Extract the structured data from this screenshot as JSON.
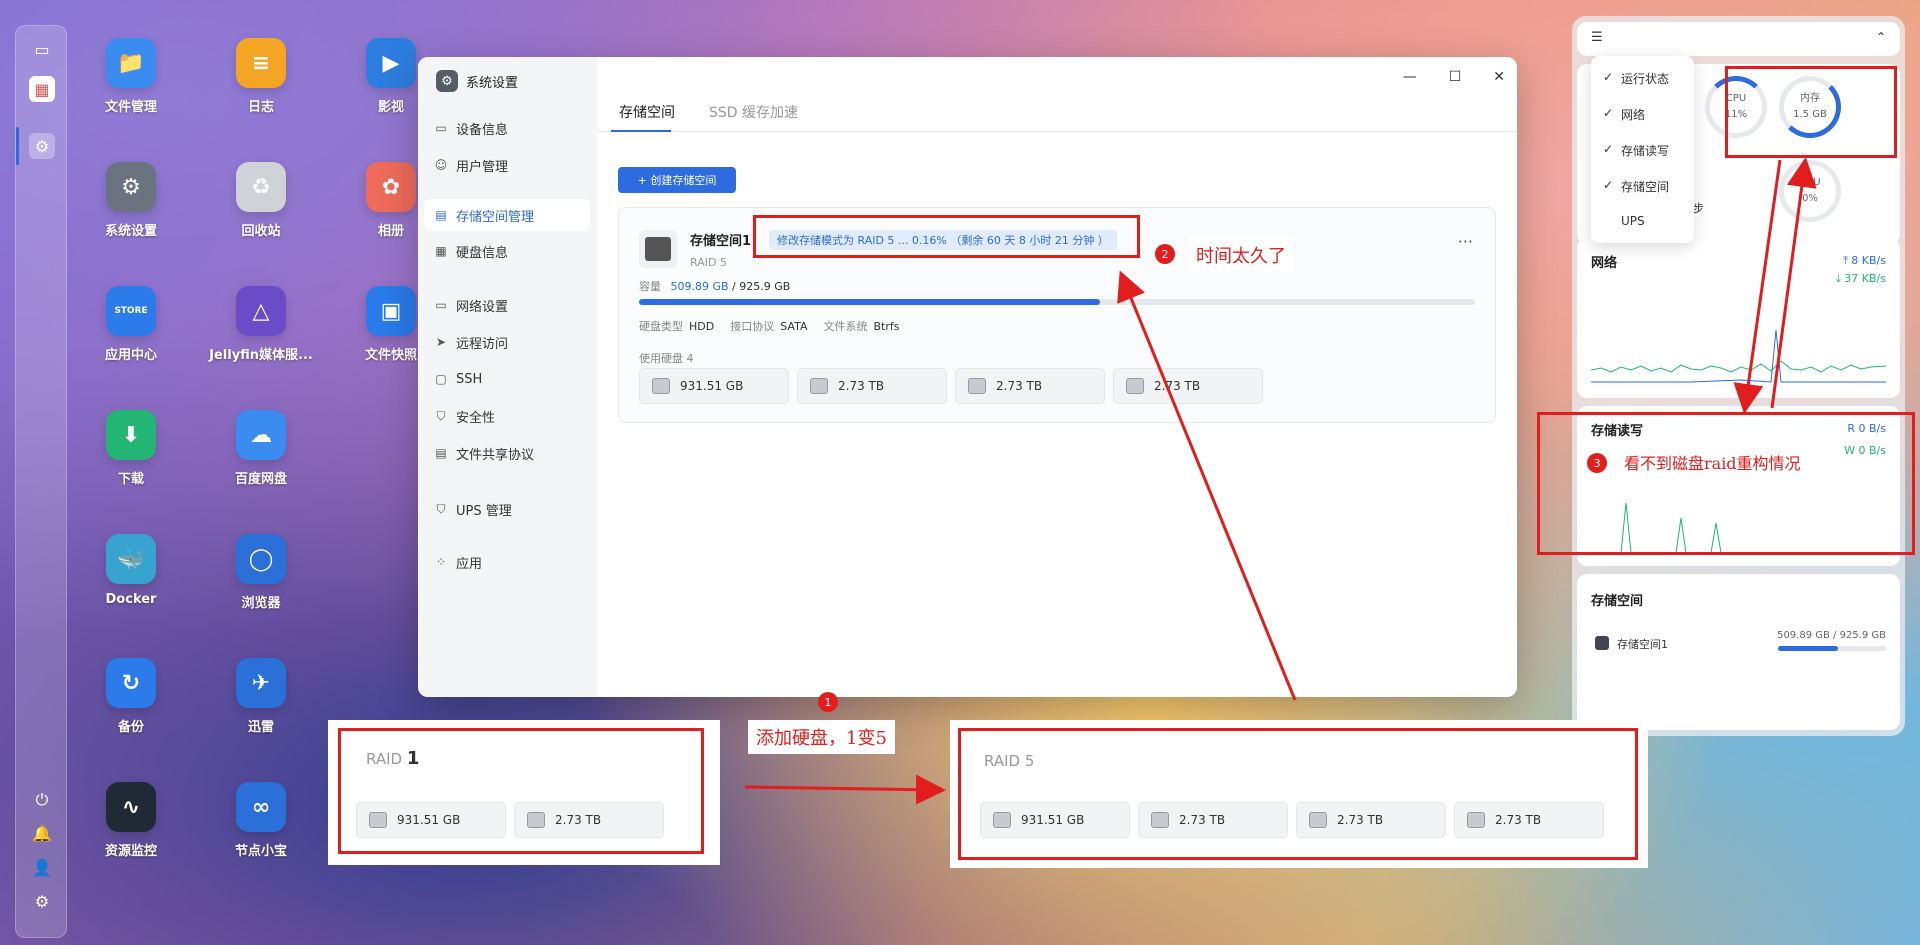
{
  "desktop_icons": [
    {
      "label": "文件管理",
      "color": "#3b8cf0",
      "glyph": "📁"
    },
    {
      "label": "日志",
      "color": "#f5a524",
      "glyph": "≡"
    },
    {
      "label": "影视",
      "color": "#2d7ee0",
      "glyph": "▶"
    },
    {
      "label": "系统设置",
      "color": "#6b7280",
      "glyph": "⚙"
    },
    {
      "label": "回收站",
      "color": "#cfd3d8",
      "glyph": "♻"
    },
    {
      "label": "相册",
      "color": "#ef6b5b",
      "glyph": "✿"
    },
    {
      "label": "应用中心",
      "color": "#2b7bea",
      "glyph": "STORE"
    },
    {
      "label": "Jellyfin媒体服...",
      "color": "#6a4cc9",
      "glyph": "△"
    },
    {
      "label": "文件快照",
      "color": "#2b7bea",
      "glyph": "▣"
    },
    {
      "label": "下载",
      "color": "#22b573",
      "glyph": "⬇"
    },
    {
      "label": "百度网盘",
      "color": "#3b8cf0",
      "glyph": "☁"
    },
    {
      "label": "Docker",
      "color": "#38a3d1",
      "glyph": "🐳"
    },
    {
      "label": "浏览器",
      "color": "#2b6fd8",
      "glyph": "◯"
    },
    {
      "label": "备份",
      "color": "#2b7bea",
      "glyph": "↻"
    },
    {
      "label": "迅雷",
      "color": "#2b6fd8",
      "glyph": "✈"
    },
    {
      "label": "资源监控",
      "color": "#1f2a36",
      "glyph": "∿"
    },
    {
      "label": "节点小宝",
      "color": "#2b6fd8",
      "glyph": "∞"
    }
  ],
  "window": {
    "title": "系统设置",
    "nav": [
      {
        "label": "设备信息",
        "icon": "device-icon",
        "glyph": "▭"
      },
      {
        "label": "用户管理",
        "icon": "user-icon",
        "glyph": "☺"
      },
      {
        "label": "存储空间管理",
        "icon": "storage-icon",
        "glyph": "▤",
        "active": true
      },
      {
        "label": "硬盘信息",
        "icon": "disk-icon",
        "glyph": "▦"
      },
      {
        "label": "网络设置",
        "icon": "network-icon",
        "glyph": "▭"
      },
      {
        "label": "远程访问",
        "icon": "remote-icon",
        "glyph": "➤"
      },
      {
        "label": "SSH",
        "icon": "ssh-icon",
        "glyph": "▢"
      },
      {
        "label": "安全性",
        "icon": "shield-icon",
        "glyph": "⛉"
      },
      {
        "label": "文件共享协议",
        "icon": "file-share-icon",
        "glyph": "▤"
      },
      {
        "label": "UPS 管理",
        "icon": "ups-icon",
        "glyph": "⛉"
      },
      {
        "label": "应用",
        "icon": "apps-icon",
        "glyph": "⁘"
      }
    ],
    "tabs": [
      "存储空间",
      "SSD 缓存加速"
    ],
    "create_button": "+ 创建存储空间",
    "pool": {
      "name": "存储空间1",
      "raid": "RAID 5",
      "status": "修改存储模式为 RAID 5 ... 0.16%  （剩余 60 天 8 小时 21 分钟 ）",
      "capacity_label": "容量",
      "capacity_used": "509.89 GB",
      "capacity_total": " / 925.9 GB",
      "usage_fraction": 0.551,
      "disk_type_label": "硬盘类型",
      "disk_type": "HDD",
      "interface_label": "接口协议",
      "interface": "SATA",
      "fs_label": "文件系统",
      "fs": "Btrfs",
      "used_disks_label": "使用硬盘 4",
      "disks": [
        "931.51 GB",
        "2.73 TB",
        "2.73 TB",
        "2.73 TB"
      ],
      "more": "···"
    }
  },
  "right_panel": {
    "dropdown": [
      {
        "label": "运行状态",
        "checked": true
      },
      {
        "label": "网络",
        "checked": true
      },
      {
        "label": "存储读写",
        "checked": true
      },
      {
        "label": "存储空间",
        "checked": true
      },
      {
        "label": "UPS",
        "checked": false
      }
    ],
    "cpu": {
      "label": "CPU",
      "value": "11%"
    },
    "mem": {
      "label": "内存",
      "value": "1.5 GB"
    },
    "gpu": {
      "label": "GPU",
      "value": "0%"
    },
    "partial_text": "步",
    "network": {
      "title": "网络",
      "up": "8 KB/s",
      "down": "37 KB/s"
    },
    "storage_io": {
      "title": "存储读写",
      "read": "0 B/s",
      "write": "0 B/s",
      "r": "R",
      "w": "W"
    },
    "storage": {
      "title": "存储空间",
      "name": "存储空间1",
      "usage": "509.89 GB / 925.9 GB",
      "fraction": 0.551
    }
  },
  "annotations": {
    "n1": "1",
    "n2": "2",
    "n3": "3",
    "a1": "添加硬盘，1变5",
    "a2": "时间太久了",
    "a3": "看不到磁盘raid重构情况",
    "raid1_title": "RAID",
    "raid1_num": "1",
    "raid1_disks": [
      "931.51 GB",
      "2.73 TB"
    ],
    "raid5_title": "RAID 5",
    "raid5_disks": [
      "931.51 GB",
      "2.73 TB",
      "2.73 TB",
      "2.73 TB"
    ]
  }
}
